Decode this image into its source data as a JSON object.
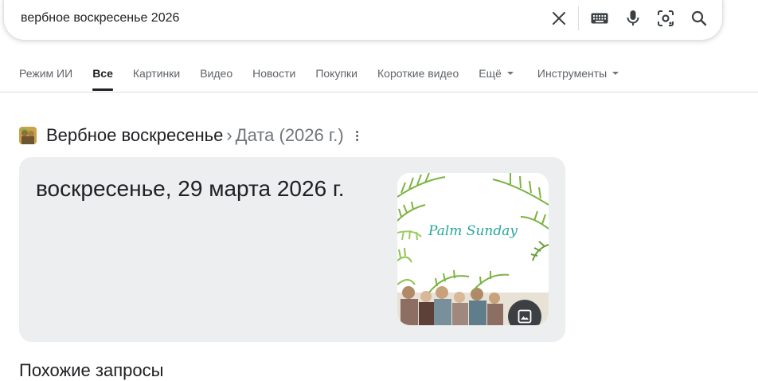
{
  "search": {
    "query": "вербное воскресенье 2026",
    "icons": [
      "close-icon",
      "keyboard-icon",
      "microphone-icon",
      "lens-icon",
      "search-icon"
    ]
  },
  "tabs": [
    {
      "label": "Режим ИИ"
    },
    {
      "label": "Все",
      "active": true
    },
    {
      "label": "Картинки"
    },
    {
      "label": "Видео"
    },
    {
      "label": "Новости"
    },
    {
      "label": "Покупки"
    },
    {
      "label": "Короткие видео"
    },
    {
      "label": "Ещё",
      "dropdown": true
    },
    {
      "label": "Инструменты",
      "dropdown": true
    }
  ],
  "answer": {
    "entity": "Вербное воскресенье",
    "separator": "›",
    "attribute": "Дата (2026 г.)",
    "value": "воскресенье, 29 марта 2026 г.",
    "image_caption": "Palm Sunday"
  },
  "related": {
    "heading": "Похожие запросы"
  },
  "colors": {
    "tab_active": "#202124",
    "tab_inactive": "#5f6368",
    "card_bg": "#eceef0",
    "palm_green": "#7cb342",
    "caption_teal": "#26a69a"
  }
}
